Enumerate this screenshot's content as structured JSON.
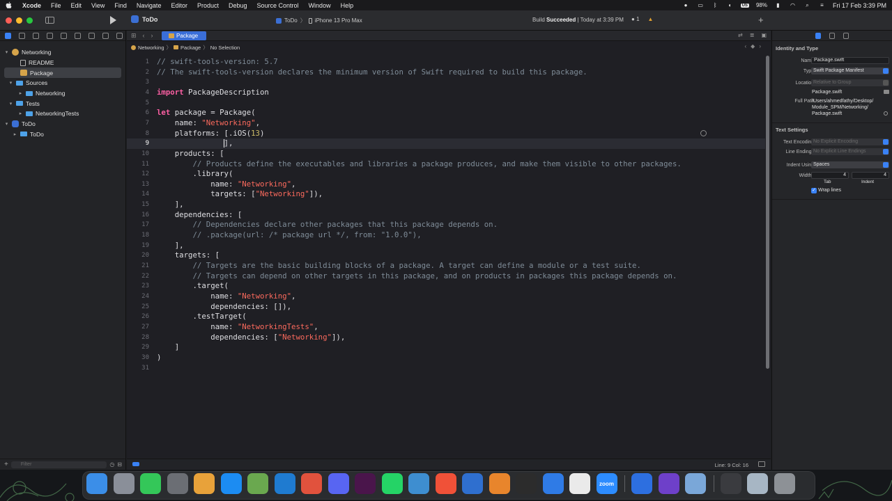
{
  "menubar": {
    "app_name": "Xcode",
    "items": [
      "File",
      "Edit",
      "View",
      "Find",
      "Navigate",
      "Editor",
      "Product",
      "Debug",
      "Source Control",
      "Window",
      "Help"
    ],
    "keyboard_layout": "US",
    "battery": "98%",
    "clock": "Fri 17 Feb  3:39 PM"
  },
  "toolbar": {
    "project_name": "ToDo",
    "scheme_target": "ToDo",
    "scheme_device": "iPhone 13 Pro Max",
    "build_status_prefix": "Build ",
    "build_status_bold": "Succeeded",
    "build_status_suffix": " | Today at 3:39 PM",
    "warning_count": "1",
    "colors": {
      "close": "#ff5f57",
      "minimize": "#febc2e",
      "zoom": "#28c840",
      "accent": "#3a6ed8"
    }
  },
  "navigator": {
    "tree": [
      {
        "label": "Networking",
        "icon": "package-project-icon",
        "level": 0,
        "disclosure": "open"
      },
      {
        "label": "README",
        "icon": "document-icon",
        "level": 1,
        "disclosure": ""
      },
      {
        "label": "Package",
        "icon": "package-icon",
        "level": 1,
        "disclosure": "",
        "selected": true
      },
      {
        "label": "Sources",
        "icon": "folder-icon",
        "level": 1,
        "disclosure": "open"
      },
      {
        "label": "Networking",
        "icon": "folder-icon",
        "level": 2,
        "disclosure": "closed"
      },
      {
        "label": "Tests",
        "icon": "folder-icon",
        "level": 1,
        "disclosure": "open"
      },
      {
        "label": "NetworkingTests",
        "icon": "folder-icon",
        "level": 2,
        "disclosure": "closed"
      },
      {
        "label": "ToDo",
        "icon": "app-project-icon",
        "level": 0,
        "disclosure": "open"
      },
      {
        "label": "ToDo",
        "icon": "folder-icon",
        "level": 1,
        "disclosure": "closed"
      }
    ],
    "filter_placeholder": "Filter"
  },
  "editor": {
    "tab_label": "Package",
    "jump_bar": [
      "Networking",
      "Package",
      "No Selection"
    ],
    "current_line": 9,
    "cursor_position": "Line: 9  Col: 16",
    "lines": [
      [
        [
          "com",
          "// swift-tools-version: 5.7"
        ]
      ],
      [
        [
          "com",
          "// The swift-tools-version declares the minimum version of Swift required to build this package."
        ]
      ],
      [],
      [
        [
          "kw",
          "import"
        ],
        [
          "txt",
          " PackageDescription"
        ]
      ],
      [],
      [
        [
          "kw",
          "let"
        ],
        [
          "txt",
          " package = Package("
        ]
      ],
      [
        [
          "txt",
          "    name: "
        ],
        [
          "str",
          "\"Networking\""
        ],
        [
          "txt",
          ","
        ]
      ],
      [
        [
          "txt",
          "    platforms: [.iOS("
        ],
        [
          "num",
          "13"
        ],
        [
          "txt",
          ")"
        ]
      ],
      [
        [
          "txt",
          "               ],"
        ]
      ],
      [
        [
          "txt",
          "    products: ["
        ]
      ],
      [
        [
          "com",
          "        // Products define the executables and libraries a package produces, and make them visible to other packages."
        ]
      ],
      [
        [
          "txt",
          "        .library("
        ]
      ],
      [
        [
          "txt",
          "            name: "
        ],
        [
          "str",
          "\"Networking\""
        ],
        [
          "txt",
          ","
        ]
      ],
      [
        [
          "txt",
          "            targets: ["
        ],
        [
          "str",
          "\"Networking\""
        ],
        [
          "txt",
          "]),"
        ]
      ],
      [
        [
          "txt",
          "    ],"
        ]
      ],
      [
        [
          "txt",
          "    dependencies: ["
        ]
      ],
      [
        [
          "com",
          "        // Dependencies declare other packages that this package depends on."
        ]
      ],
      [
        [
          "com",
          "        // .package(url: /* package url */, from: \"1.0.0\"),"
        ]
      ],
      [
        [
          "txt",
          "    ],"
        ]
      ],
      [
        [
          "txt",
          "    targets: ["
        ]
      ],
      [
        [
          "com",
          "        // Targets are the basic building blocks of a package. A target can define a module or a test suite."
        ]
      ],
      [
        [
          "com",
          "        // Targets can depend on other targets in this package, and on products in packages this package depends on."
        ]
      ],
      [
        [
          "txt",
          "        .target("
        ]
      ],
      [
        [
          "txt",
          "            name: "
        ],
        [
          "str",
          "\"Networking\""
        ],
        [
          "txt",
          ","
        ]
      ],
      [
        [
          "txt",
          "            dependencies: []),"
        ]
      ],
      [
        [
          "txt",
          "        .testTarget("
        ]
      ],
      [
        [
          "txt",
          "            name: "
        ],
        [
          "str",
          "\"NetworkingTests\""
        ],
        [
          "txt",
          ","
        ]
      ],
      [
        [
          "txt",
          "            dependencies: ["
        ],
        [
          "str",
          "\"Networking\""
        ],
        [
          "txt",
          "]),"
        ]
      ],
      [
        [
          "txt",
          "    ]"
        ]
      ],
      [
        [
          "txt",
          ")"
        ]
      ],
      []
    ]
  },
  "inspector": {
    "identity_title": "Identity and Type",
    "name_label": "Name",
    "name_value": "Package.swift",
    "type_label": "Type",
    "type_value": "Swift Package Manifest",
    "location_label": "Location",
    "location_value": "Relative to Group",
    "location_file": "Package.swift",
    "full_path_label": "Full Path",
    "full_path_lines": [
      "/Users/ahmedfathy/Desktop/",
      "Module_SPM/Networking/",
      "Package.swift"
    ],
    "text_settings_title": "Text Settings",
    "encoding_label": "Text Encoding",
    "encoding_value": "No Explicit Encoding",
    "line_endings_label": "Line Endings",
    "line_endings_value": "No Explicit Line Endings",
    "indent_label": "Indent Using",
    "indent_value": "Spaces",
    "widths_label": "Widths",
    "tab_width": "4",
    "indent_width": "4",
    "tab_caption": "Tab",
    "indent_caption": "Indent",
    "wrap_label": "Wrap lines"
  },
  "dock": {
    "apps": [
      {
        "name": "Finder",
        "color": "#3b8ee8",
        "glyph": ""
      },
      {
        "name": "Launchpad",
        "color": "#8a8f99",
        "glyph": ""
      },
      {
        "name": "Messages",
        "color": "#34c759",
        "glyph": ""
      },
      {
        "name": "Screenshot",
        "color": "#6b6e74",
        "glyph": ""
      },
      {
        "name": "Photos",
        "color": "#e8a23a",
        "glyph": ""
      },
      {
        "name": "App Store",
        "color": "#1c8cf2",
        "glyph": ""
      },
      {
        "name": "Android Studio",
        "color": "#6aa84f",
        "glyph": ""
      },
      {
        "name": "Visual Studio Code",
        "color": "#1f7bd0",
        "glyph": ""
      },
      {
        "name": "Git Client",
        "color": "#e1523d",
        "glyph": ""
      },
      {
        "name": "Discord",
        "color": "#5865f2",
        "glyph": ""
      },
      {
        "name": "Slack",
        "color": "#4a154b",
        "glyph": ""
      },
      {
        "name": "WhatsApp",
        "color": "#25d366",
        "glyph": ""
      },
      {
        "name": "Proxyman",
        "color": "#3e8ed0",
        "glyph": ""
      },
      {
        "name": "Swift Playgrounds",
        "color": "#f05138",
        "glyph": ""
      },
      {
        "name": "Instruments",
        "color": "#2f6fcf",
        "glyph": ""
      },
      {
        "name": "Sourcetree",
        "color": "#e8852c",
        "glyph": ""
      },
      {
        "name": "Figma",
        "color": "#2c2c2c",
        "glyph": ""
      },
      {
        "name": "Xcode",
        "color": "#2f7be6",
        "glyph": ""
      },
      {
        "name": "Chrome",
        "color": "#eaeaea",
        "glyph": ""
      },
      {
        "name": "Zoom",
        "color": "#2d8cff",
        "glyph": "zoom"
      },
      {
        "name": "Simulator",
        "color": "#2d6fe0",
        "glyph": ""
      },
      {
        "name": "GitHub Desktop",
        "color": "#6e40c9",
        "glyph": ""
      },
      {
        "name": "Preview",
        "color": "#7aa7d8",
        "glyph": ""
      },
      {
        "name": "Recent Document",
        "color": "#3a3b3f",
        "glyph": ""
      },
      {
        "name": "Downloads",
        "color": "#a7b6c4",
        "glyph": ""
      },
      {
        "name": "Trash",
        "color": "#8d9196",
        "glyph": ""
      }
    ]
  }
}
